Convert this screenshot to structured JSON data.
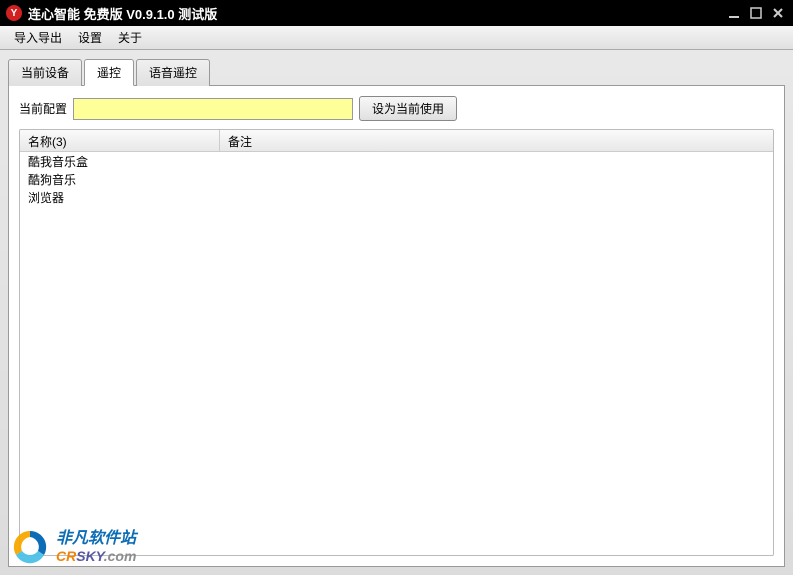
{
  "window": {
    "title": "连心智能 免费版 V0.9.1.0 测试版"
  },
  "menu": {
    "import_export": "导入导出",
    "settings": "设置",
    "about": "关于"
  },
  "tabs": {
    "current_device": "当前设备",
    "remote": "遥控",
    "voice_remote": "语音遥控"
  },
  "config": {
    "label": "当前配置",
    "value": "",
    "set_button": "设为当前使用"
  },
  "list": {
    "header_name": "名称(3)",
    "header_remark": "备注",
    "rows": [
      {
        "name": "酷我音乐盒",
        "remark": ""
      },
      {
        "name": "酷狗音乐",
        "remark": ""
      },
      {
        "name": "浏览器",
        "remark": ""
      }
    ]
  },
  "watermark": {
    "title": "非凡软件站",
    "sub_prefix": "CR",
    "sub_mid": "SKY",
    "sub_suffix": ".com"
  }
}
